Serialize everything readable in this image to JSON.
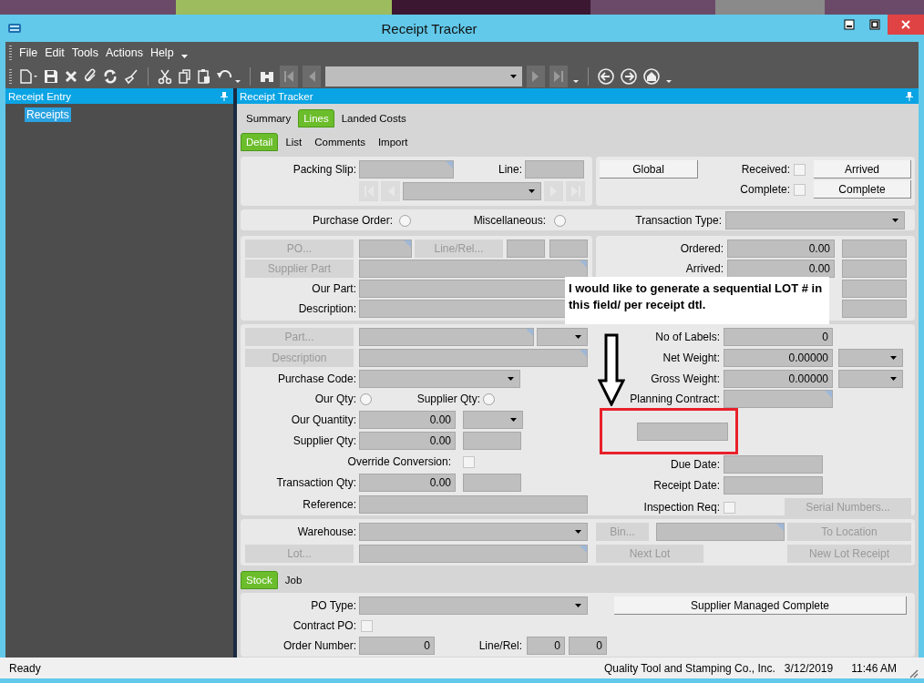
{
  "window": {
    "title": "Receipt Tracker"
  },
  "menu": [
    {
      "label": "File"
    },
    {
      "label": "Edit"
    },
    {
      "label": "Tools"
    },
    {
      "label": "Actions"
    },
    {
      "label": "Help"
    }
  ],
  "left_panel": {
    "title": "Receipt Entry",
    "tree": [
      {
        "label": "Receipts",
        "selected": true
      }
    ]
  },
  "main_panel": {
    "title": "Receipt Tracker"
  },
  "tabs": [
    {
      "label": "Summary",
      "selected": false
    },
    {
      "label": "Lines",
      "selected": true
    },
    {
      "label": "Landed Costs",
      "selected": false
    }
  ],
  "detail_tabs": [
    {
      "label": "Detail",
      "selected": true
    },
    {
      "label": "List",
      "selected": false
    },
    {
      "label": "Comments",
      "selected": false
    },
    {
      "label": "Import",
      "selected": false
    }
  ],
  "header": {
    "packing_slip_label": "Packing Slip:",
    "line_label": "Line:",
    "received": {
      "label": "Received:",
      "checked": false
    },
    "complete": {
      "label": "Complete:",
      "checked": false
    },
    "buttons": [
      {
        "label": "Global",
        "disabled": false
      },
      {
        "label": "Arrived",
        "disabled": false
      },
      {
        "label": "Complete",
        "disabled": false
      }
    ]
  },
  "source": {
    "options": [
      {
        "label": "Purchase Order:",
        "selected": false
      },
      {
        "label": "Miscellaneous:",
        "selected": false
      }
    ],
    "transaction_type_label": "Transaction Type:"
  },
  "po": {
    "buttons": [
      {
        "label": "PO...",
        "disabled": true
      },
      {
        "label": "Line/Rel...",
        "disabled": true
      },
      {
        "label": "Supplier Part",
        "disabled": true
      }
    ],
    "our_part_label": "Our Part:",
    "description_label": "Description:"
  },
  "totals": [
    {
      "label": "Ordered:",
      "value": "0.00"
    },
    {
      "label": "Arrived:",
      "value": "0.00"
    }
  ],
  "part": {
    "buttons": [
      {
        "label": "Part...",
        "disabled": true
      },
      {
        "label": "Description",
        "disabled": true
      }
    ],
    "purchase_code_label": "Purchase Code:",
    "qty_basis": [
      {
        "label": "Our Qty:",
        "selected": false
      },
      {
        "label": "Supplier Qty:",
        "selected": false
      }
    ],
    "our_quantity": {
      "label": "Our Quantity:",
      "value": "0.00"
    },
    "supplier_qty": {
      "label": "Supplier Qty:",
      "value": "0.00"
    },
    "override_conversion": {
      "label": "Override Conversion:",
      "checked": false
    },
    "transaction_qty": {
      "label": "Transaction Qty:",
      "value": "0.00"
    },
    "reference_label": "Reference:"
  },
  "labels": {
    "no_of_labels": {
      "label": "No of Labels:",
      "value": "0"
    },
    "net_weight": {
      "label": "Net Weight:",
      "value": "0.00000"
    },
    "gross_weight": {
      "label": "Gross Weight:",
      "value": "0.00000"
    },
    "planning_contract_label": "Planning Contract:",
    "due_date_label": "Due Date:",
    "receipt_date_label": "Receipt Date:",
    "inspection_req": {
      "label": "Inspection Req:",
      "checked": false
    },
    "serial_numbers_button": {
      "label": "Serial Numbers...",
      "disabled": true
    }
  },
  "location": {
    "warehouse_label": "Warehouse:",
    "buttons": [
      {
        "label": "Bin...",
        "disabled": true
      },
      {
        "label": "To Location",
        "disabled": true
      },
      {
        "label": "Lot...",
        "disabled": true
      },
      {
        "label": "Next Lot",
        "disabled": true
      },
      {
        "label": "New Lot Receipt",
        "disabled": true
      }
    ]
  },
  "stock_tabs": [
    {
      "label": "Stock",
      "selected": true
    },
    {
      "label": "Job",
      "selected": false
    }
  ],
  "stock": {
    "po_type_label": "PO Type:",
    "supplier_managed_complete_button": {
      "label": "Supplier Managed Complete",
      "disabled": false
    },
    "contract_po": {
      "label": "Contract PO:",
      "checked": false
    },
    "order_number": {
      "label": "Order Number:",
      "value": "0"
    },
    "line_rel": {
      "label": "Line/Rel:",
      "values": [
        "0",
        "0"
      ]
    }
  },
  "annotation": {
    "text": "I would like to generate a sequential LOT # in this field/ per receipt dtl."
  },
  "status_bar": {
    "text": "Ready",
    "company": "Quality Tool and Stamping Co., Inc.",
    "date": "3/12/2019",
    "time": "11:46 AM"
  }
}
